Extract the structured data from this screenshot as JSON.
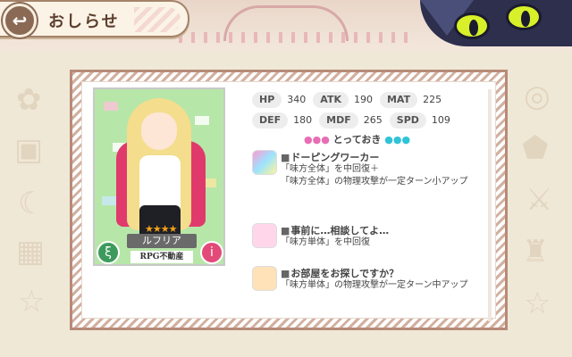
{
  "header": {
    "title": "おしらせ",
    "back_symbol": "↩"
  },
  "colors": {
    "accent": "#8b6a55",
    "frame": "#b88a78",
    "trump_pink": "#e86eb4",
    "trump_cyan": "#2fc3d8"
  },
  "card": {
    "name": "ルフリア",
    "source": "RPG不動産",
    "rarity_stars": "★★★★",
    "left_icon": "ξ",
    "right_icon": "i"
  },
  "stats": [
    [
      {
        "label": "HP",
        "value": "340"
      },
      {
        "label": "ATK",
        "value": "190"
      },
      {
        "label": "MAT",
        "value": "225"
      }
    ],
    [
      {
        "label": "DEF",
        "value": "180"
      },
      {
        "label": "MDF",
        "value": "265"
      },
      {
        "label": "SPD",
        "value": "109"
      }
    ]
  ],
  "trump_title": {
    "left_dots": "●●●",
    "text": "とっておき",
    "right_dots": "●●●"
  },
  "skills": [
    {
      "name": "ドーピングワーカー",
      "icon": "sp-icon",
      "desc": "「味方全体」を中回復＋\n「味方全体」の物理攻撃が一定ターン小アップ"
    },
    {
      "name": "事前に…相談してよ…",
      "icon": "heart-icon",
      "desc": "「味方単体」を中回復"
    },
    {
      "name": "お部屋をお探しですか？",
      "icon": "flame-icon",
      "desc": "「味方単体」の物理攻撃が一定ターン中アップ"
    }
  ]
}
